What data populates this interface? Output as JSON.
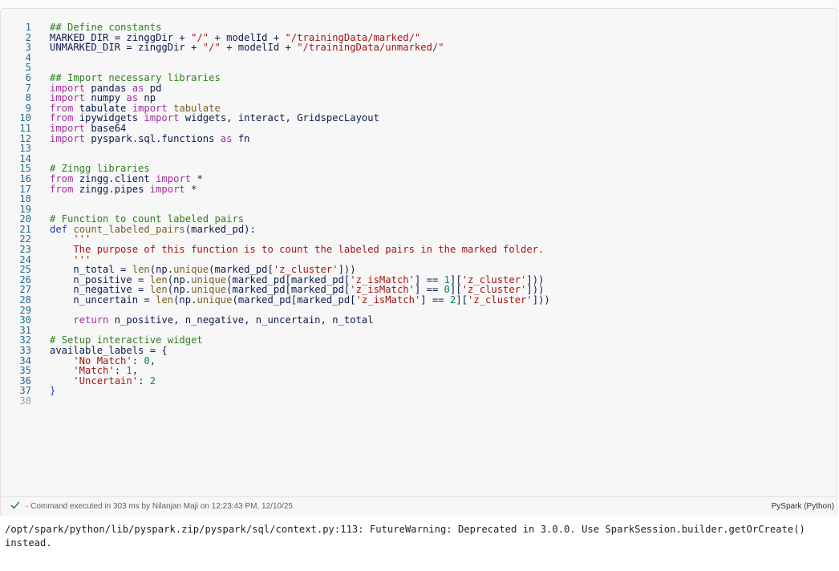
{
  "cell": {
    "lines": [
      {
        "n": "1",
        "tokens": [
          {
            "c": "comment",
            "t": "## Define constants"
          }
        ]
      },
      {
        "n": "2",
        "tokens": [
          {
            "c": "name",
            "t": "MARKED_DIR = zinggDir + "
          },
          {
            "c": "str",
            "t": "\"/\""
          },
          {
            "c": "name",
            "t": " + modelId + "
          },
          {
            "c": "str",
            "t": "\"/trainingData/marked/\""
          }
        ]
      },
      {
        "n": "3",
        "tokens": [
          {
            "c": "name",
            "t": "UNMARKED_DIR = zinggDir + "
          },
          {
            "c": "str",
            "t": "\"/\""
          },
          {
            "c": "name",
            "t": " + modelId + "
          },
          {
            "c": "str",
            "t": "\"/trainingData/unmarked/\""
          }
        ]
      },
      {
        "n": "4",
        "tokens": []
      },
      {
        "n": "5",
        "tokens": []
      },
      {
        "n": "6",
        "tokens": [
          {
            "c": "comment",
            "t": "## Import necessary libraries"
          }
        ]
      },
      {
        "n": "7",
        "tokens": [
          {
            "c": "kw",
            "t": "import"
          },
          {
            "c": "name",
            "t": " pandas "
          },
          {
            "c": "kw",
            "t": "as"
          },
          {
            "c": "name",
            "t": " pd"
          }
        ]
      },
      {
        "n": "8",
        "tokens": [
          {
            "c": "kw",
            "t": "import"
          },
          {
            "c": "name",
            "t": " numpy "
          },
          {
            "c": "kw",
            "t": "as"
          },
          {
            "c": "name",
            "t": " np"
          }
        ]
      },
      {
        "n": "9",
        "tokens": [
          {
            "c": "kw",
            "t": "from"
          },
          {
            "c": "name",
            "t": " tabulate "
          },
          {
            "c": "kw",
            "t": "import"
          },
          {
            "c": "builtin",
            "t": " tabulate"
          }
        ]
      },
      {
        "n": "10",
        "tokens": [
          {
            "c": "kw",
            "t": "from"
          },
          {
            "c": "name",
            "t": " ipywidgets "
          },
          {
            "c": "kw",
            "t": "import"
          },
          {
            "c": "name",
            "t": " widgets, interact, GridspecLayout"
          }
        ]
      },
      {
        "n": "11",
        "tokens": [
          {
            "c": "kw",
            "t": "import"
          },
          {
            "c": "name",
            "t": " base64"
          }
        ]
      },
      {
        "n": "12",
        "tokens": [
          {
            "c": "kw",
            "t": "import"
          },
          {
            "c": "name",
            "t": " pyspark.sql.functions "
          },
          {
            "c": "kw",
            "t": "as"
          },
          {
            "c": "name",
            "t": " fn"
          }
        ]
      },
      {
        "n": "13",
        "tokens": []
      },
      {
        "n": "14",
        "tokens": []
      },
      {
        "n": "15",
        "tokens": [
          {
            "c": "comment",
            "t": "# Zingg libraries"
          }
        ]
      },
      {
        "n": "16",
        "tokens": [
          {
            "c": "kw",
            "t": "from"
          },
          {
            "c": "name",
            "t": " zingg.client "
          },
          {
            "c": "kw",
            "t": "import"
          },
          {
            "c": "name",
            "t": " *"
          }
        ]
      },
      {
        "n": "17",
        "tokens": [
          {
            "c": "kw",
            "t": "from"
          },
          {
            "c": "name",
            "t": " zingg.pipes "
          },
          {
            "c": "kw",
            "t": "import"
          },
          {
            "c": "name",
            "t": " *"
          }
        ]
      },
      {
        "n": "18",
        "tokens": []
      },
      {
        "n": "19",
        "tokens": []
      },
      {
        "n": "20",
        "tokens": [
          {
            "c": "comment",
            "t": "# Function to count labeled pairs"
          }
        ]
      },
      {
        "n": "21",
        "tokens": [
          {
            "c": "def",
            "t": "def"
          },
          {
            "c": "name",
            "t": " "
          },
          {
            "c": "builtin",
            "t": "count_labeled_pairs"
          },
          {
            "c": "name",
            "t": "(marked_pd):"
          }
        ]
      },
      {
        "n": "22",
        "tokens": [
          {
            "c": "str",
            "t": "    '''"
          }
        ]
      },
      {
        "n": "23",
        "tokens": [
          {
            "c": "str",
            "t": "    The purpose of this function is to count the labeled pairs in the marked folder."
          }
        ]
      },
      {
        "n": "24",
        "tokens": [
          {
            "c": "str",
            "t": "    '''"
          }
        ]
      },
      {
        "n": "25",
        "tokens": [
          {
            "c": "name",
            "t": "    n_total = "
          },
          {
            "c": "builtin",
            "t": "len"
          },
          {
            "c": "name",
            "t": "(np."
          },
          {
            "c": "builtin",
            "t": "unique"
          },
          {
            "c": "name",
            "t": "(marked_pd["
          },
          {
            "c": "str",
            "t": "'z_cluster'"
          },
          {
            "c": "name",
            "t": "]))"
          }
        ]
      },
      {
        "n": "26",
        "tokens": [
          {
            "c": "name",
            "t": "    n_positive = "
          },
          {
            "c": "builtin",
            "t": "len"
          },
          {
            "c": "name",
            "t": "(np."
          },
          {
            "c": "builtin",
            "t": "unique"
          },
          {
            "c": "name",
            "t": "(marked_pd[marked_pd["
          },
          {
            "c": "str",
            "t": "'z_isMatch'"
          },
          {
            "c": "name",
            "t": "] == "
          },
          {
            "c": "num",
            "t": "1"
          },
          {
            "c": "name",
            "t": "]["
          },
          {
            "c": "str",
            "t": "'z_cluster'"
          },
          {
            "c": "name",
            "t": "]))"
          }
        ]
      },
      {
        "n": "27",
        "tokens": [
          {
            "c": "name",
            "t": "    n_negative = "
          },
          {
            "c": "builtin",
            "t": "len"
          },
          {
            "c": "name",
            "t": "(np."
          },
          {
            "c": "builtin",
            "t": "unique"
          },
          {
            "c": "name",
            "t": "(marked_pd[marked_pd["
          },
          {
            "c": "str",
            "t": "'z_isMatch'"
          },
          {
            "c": "name",
            "t": "] == "
          },
          {
            "c": "num",
            "t": "0"
          },
          {
            "c": "name",
            "t": "]["
          },
          {
            "c": "str",
            "t": "'z_cluster'"
          },
          {
            "c": "name",
            "t": "]))"
          }
        ]
      },
      {
        "n": "28",
        "tokens": [
          {
            "c": "name",
            "t": "    n_uncertain = "
          },
          {
            "c": "builtin",
            "t": "len"
          },
          {
            "c": "name",
            "t": "(np."
          },
          {
            "c": "builtin",
            "t": "unique"
          },
          {
            "c": "name",
            "t": "(marked_pd[marked_pd["
          },
          {
            "c": "str",
            "t": "'z_isMatch'"
          },
          {
            "c": "name",
            "t": "] == "
          },
          {
            "c": "num",
            "t": "2"
          },
          {
            "c": "name",
            "t": "]["
          },
          {
            "c": "str",
            "t": "'z_cluster'"
          },
          {
            "c": "name",
            "t": "]))"
          }
        ]
      },
      {
        "n": "29",
        "tokens": []
      },
      {
        "n": "30",
        "tokens": [
          {
            "c": "kw",
            "t": "    return"
          },
          {
            "c": "name",
            "t": " n_positive, n_negative, n_uncertain, n_total"
          }
        ]
      },
      {
        "n": "31",
        "tokens": []
      },
      {
        "n": "32",
        "tokens": [
          {
            "c": "comment",
            "t": "# Setup interactive widget"
          }
        ]
      },
      {
        "n": "33",
        "tokens": [
          {
            "c": "name",
            "t": "available_labels = {"
          }
        ]
      },
      {
        "n": "34",
        "tokens": [
          {
            "c": "str",
            "t": "    'No Match'"
          },
          {
            "c": "name",
            "t": ": "
          },
          {
            "c": "num",
            "t": "0"
          },
          {
            "c": "name",
            "t": ","
          }
        ]
      },
      {
        "n": "35",
        "tokens": [
          {
            "c": "str",
            "t": "    'Match'"
          },
          {
            "c": "name",
            "t": ": "
          },
          {
            "c": "num",
            "t": "1"
          },
          {
            "c": "name",
            "t": ","
          }
        ]
      },
      {
        "n": "36",
        "tokens": [
          {
            "c": "str",
            "t": "    'Uncertain'"
          },
          {
            "c": "name",
            "t": ": "
          },
          {
            "c": "num",
            "t": "2"
          }
        ]
      },
      {
        "n": "37",
        "tokens": [
          {
            "c": "def",
            "t": "}"
          }
        ]
      },
      {
        "n": "38",
        "tokens": [],
        "last": true
      }
    ],
    "status_text": "- Command executed in 303 ms by Nilanjan Maji on 12:23:43 PM, 12/10/25",
    "language": "PySpark (Python)"
  },
  "output": {
    "text": "/opt/spark/python/lib/pyspark.zip/pyspark/sql/context.py:113: FutureWarning: Deprecated in 3.0.0. Use SparkSession.builder.getOrCreate() instead."
  },
  "colors": {
    "comment": "#2f7d1e",
    "keyword": "#a1309c",
    "string": "#a31515",
    "number": "#098658",
    "line_number": "#236c8e",
    "check": "#2e8b3a"
  },
  "icons": {
    "status": "check-icon"
  }
}
